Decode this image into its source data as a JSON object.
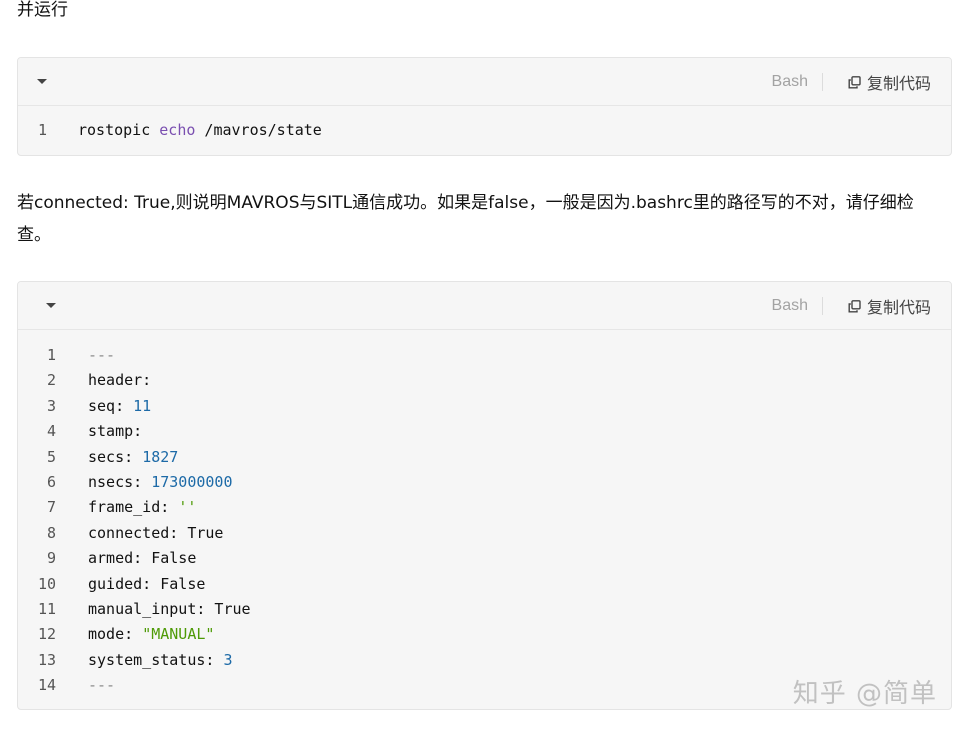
{
  "intro_text": "并运行",
  "block1": {
    "language": "Bash",
    "copy_label": "复制代码",
    "lines": [
      {
        "n": "1",
        "parts": [
          {
            "t": "rostopic ",
            "c": ""
          },
          {
            "t": "echo",
            "c": "kw"
          },
          {
            "t": " /mavros/state",
            "c": ""
          }
        ]
      }
    ]
  },
  "explanation_text": "若connected: True,则说明MAVROS与SITL通信成功。如果是false，一般是因为.bashrc里的路径写的不对，请仔细检查。",
  "block2": {
    "language": "Bash",
    "copy_label": "复制代码",
    "lines": [
      {
        "n": "1",
        "parts": [
          {
            "t": "---",
            "c": "cmt"
          }
        ]
      },
      {
        "n": "2",
        "parts": [
          {
            "t": "header:",
            "c": ""
          }
        ]
      },
      {
        "n": "3",
        "parts": [
          {
            "t": "seq: ",
            "c": ""
          },
          {
            "t": "11",
            "c": "num"
          }
        ]
      },
      {
        "n": "4",
        "parts": [
          {
            "t": "stamp:",
            "c": ""
          }
        ]
      },
      {
        "n": "5",
        "parts": [
          {
            "t": "secs: ",
            "c": ""
          },
          {
            "t": "1827",
            "c": "num"
          }
        ]
      },
      {
        "n": "6",
        "parts": [
          {
            "t": "nsecs: ",
            "c": ""
          },
          {
            "t": "173000000",
            "c": "num"
          }
        ]
      },
      {
        "n": "7",
        "parts": [
          {
            "t": "frame_id: ",
            "c": ""
          },
          {
            "t": "''",
            "c": "str"
          }
        ]
      },
      {
        "n": "8",
        "parts": [
          {
            "t": "connected: True",
            "c": ""
          }
        ]
      },
      {
        "n": "9",
        "parts": [
          {
            "t": "armed: False",
            "c": ""
          }
        ]
      },
      {
        "n": "10",
        "parts": [
          {
            "t": "guided: False",
            "c": ""
          }
        ]
      },
      {
        "n": "11",
        "parts": [
          {
            "t": "manual_input: True",
            "c": ""
          }
        ]
      },
      {
        "n": "12",
        "parts": [
          {
            "t": "mode: ",
            "c": ""
          },
          {
            "t": "\"MANUAL\"",
            "c": "str"
          }
        ]
      },
      {
        "n": "13",
        "parts": [
          {
            "t": "system_status: ",
            "c": ""
          },
          {
            "t": "3",
            "c": "num"
          }
        ]
      },
      {
        "n": "14",
        "parts": [
          {
            "t": "---",
            "c": "cmt"
          }
        ]
      }
    ]
  },
  "watermark": "知乎 @简单",
  "icons": {
    "collapse": "caret-down-icon",
    "copy": "copy-icon"
  },
  "colors": {
    "keyword": "#7a4fb0",
    "number": "#1d6aa7",
    "string": "#4e9a06",
    "code_bg": "#f6f6f6"
  }
}
